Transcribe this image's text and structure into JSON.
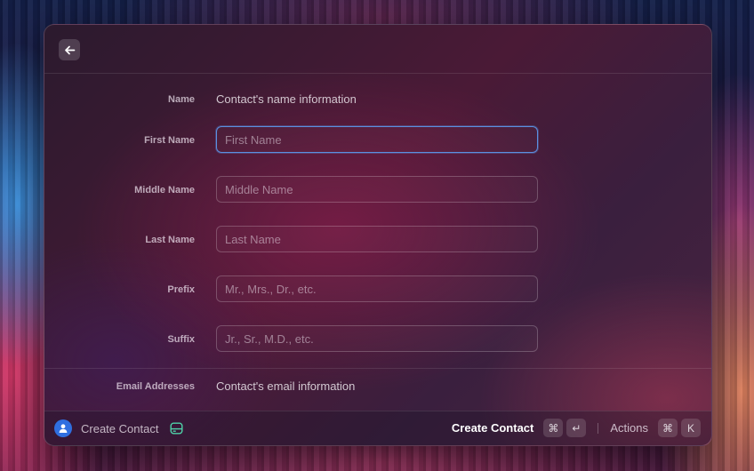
{
  "form": {
    "name_section": {
      "label": "Name",
      "description": "Contact's name information"
    },
    "fields": [
      {
        "label": "First Name",
        "placeholder": "First Name",
        "value": ""
      },
      {
        "label": "Middle Name",
        "placeholder": "Middle Name",
        "value": ""
      },
      {
        "label": "Last Name",
        "placeholder": "Last Name",
        "value": ""
      },
      {
        "label": "Prefix",
        "placeholder": "Mr., Mrs., Dr., etc.",
        "value": ""
      },
      {
        "label": "Suffix",
        "placeholder": "Jr., Sr., M.D., etc.",
        "value": ""
      }
    ],
    "email_section": {
      "label": "Email Addresses",
      "description": "Contact's email information"
    }
  },
  "footer": {
    "title": "Create Contact",
    "primary_action": "Create Contact",
    "primary_shortcut": [
      "⌘",
      "↵"
    ],
    "actions_label": "Actions",
    "actions_shortcut": [
      "⌘",
      "K"
    ]
  },
  "icons": {
    "back": "arrow-left-icon",
    "avatar": "person-icon",
    "drive": "drive-icon"
  },
  "colors": {
    "focus_ring": "#5b8fe0",
    "avatar_bg": "#2f6fe0",
    "drive_icon": "#4fd1a8"
  }
}
